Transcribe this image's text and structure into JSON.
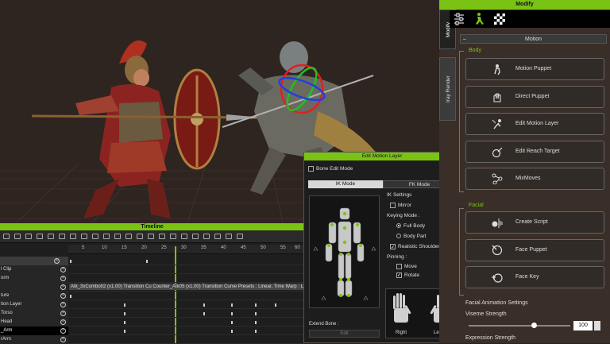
{
  "timeline": {
    "title": "Timeline",
    "ruler_ticks": [
      "5",
      "10",
      "15",
      "20",
      "25",
      "30",
      "35",
      "40",
      "45",
      "50",
      "55",
      "60"
    ],
    "rows": [
      {
        "label": "",
        "style": "dim"
      },
      {
        "label": "l Clip",
        "style": "normal"
      },
      {
        "label": "orm",
        "style": "normal"
      },
      {
        "label": "",
        "style": "normal"
      },
      {
        "label": "ture",
        "style": "normal"
      },
      {
        "label": "tion Layer",
        "style": "normal"
      },
      {
        "label": "Torso",
        "style": "normal"
      },
      {
        "label": "Head",
        "style": "normal"
      },
      {
        "label": "_Arm",
        "style": "sel"
      },
      {
        "label": "rArm",
        "style": "normal"
      }
    ],
    "clip_text": "Atk_3xCombo02 (x1.00) Transition Cu  Counter_Atk05 (x1.00) Transition Curve Presets : Linear, Time Warp : Linear"
  },
  "dialog": {
    "title": "Edit Motion Layer",
    "bone_edit_mode": "Bone Edit Mode",
    "ik_mode": "IK Mode",
    "fk_mode": "FK Mode",
    "ik_settings": "IK Settings",
    "mirror": "Mirror",
    "keying_mode": "Keying Mode :",
    "full_body": "Full Body",
    "body_part": "Body Part",
    "realistic_shoulder": "Realistic Shoulder",
    "pinning": "Pinning :",
    "move": "Move",
    "rotate": "Rotate",
    "extend_bone": "Extend Bone :",
    "edit_button": "Edit",
    "right": "Right",
    "left": "Left"
  },
  "panel": {
    "title": "Modify",
    "tabs": [
      "Modify",
      "Iray Render"
    ],
    "motion_header": "Motion",
    "body_label": "Body",
    "body_buttons": [
      "Motion Puppet",
      "Direct Puppet",
      "Edit Motion Layer",
      "Edit Reach Target",
      "MixMoves"
    ],
    "facial_label": "Facial",
    "facial_buttons": [
      "Create Script",
      "Face Puppet",
      "Face Key"
    ],
    "facial_settings": "Facial Animation Settings",
    "viseme_strength": "Viseme Strength",
    "viseme_value": "100",
    "viseme_fraction": 0.64,
    "expression_strength": "Expression Strength"
  },
  "colors": {
    "accent": "#7ac314",
    "panel_bg": "#3a2e28",
    "viewport_bg": "#2e2420",
    "gizmo_red": "#e02020",
    "gizmo_green": "#20c020",
    "gizmo_blue": "#2040e0"
  },
  "icons": [
    "motion-puppet-icon",
    "direct-puppet-icon",
    "edit-motion-layer-icon",
    "edit-reach-target-icon",
    "mixmoves-icon",
    "create-script-icon",
    "face-puppet-icon",
    "face-key-icon",
    "close-icon",
    "sliders-icon",
    "running-figure-icon",
    "checker-icon"
  ]
}
